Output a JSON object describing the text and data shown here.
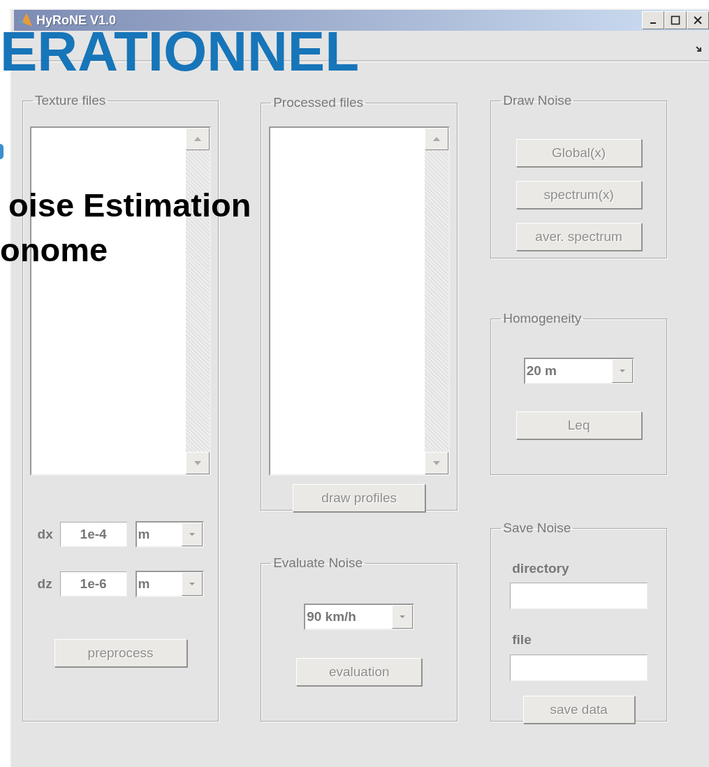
{
  "window": {
    "title": "HyRoNE V1.0"
  },
  "overlay": {
    "heading": "ERATIONNEL",
    "lines": [
      "oise Estimation",
      "onome"
    ]
  },
  "columns": [
    [
      {
        "title": "Texture files",
        "items": [
          {
            "kind": "listbox"
          },
          {
            "kind": "param",
            "label": "dx",
            "value": "1e-4",
            "unit": "m"
          },
          {
            "kind": "param",
            "label": "dz",
            "value": "1e-6",
            "unit": "m"
          },
          {
            "kind": "button",
            "label": "preprocess",
            "disabled": true
          }
        ]
      }
    ],
    [
      {
        "title": "Processed files",
        "items": [
          {
            "kind": "listbox"
          },
          {
            "kind": "button",
            "label": "draw profiles",
            "disabled": true
          }
        ]
      },
      {
        "title": "Evaluate Noise",
        "items": [
          {
            "kind": "dropdown",
            "value": "90 km/h"
          },
          {
            "kind": "button",
            "label": "evaluation",
            "disabled": true
          }
        ]
      }
    ],
    [
      {
        "title": "Draw Noise",
        "items": [
          {
            "kind": "button",
            "label": "Global(x)",
            "disabled": true
          },
          {
            "kind": "button",
            "label": "spectrum(x)",
            "disabled": true
          },
          {
            "kind": "button",
            "label": "aver. spectrum",
            "disabled": true
          }
        ]
      },
      {
        "title": "Homogeneity",
        "items": [
          {
            "kind": "dropdown",
            "value": "20 m"
          },
          {
            "kind": "button",
            "label": "Leq",
            "disabled": true
          }
        ]
      },
      {
        "title": "Save Noise",
        "items": [
          {
            "kind": "label",
            "label": "directory"
          },
          {
            "kind": "field"
          },
          {
            "kind": "label",
            "label": "file"
          },
          {
            "kind": "field"
          },
          {
            "kind": "button",
            "label": "save data",
            "disabled": true
          }
        ]
      }
    ]
  ]
}
